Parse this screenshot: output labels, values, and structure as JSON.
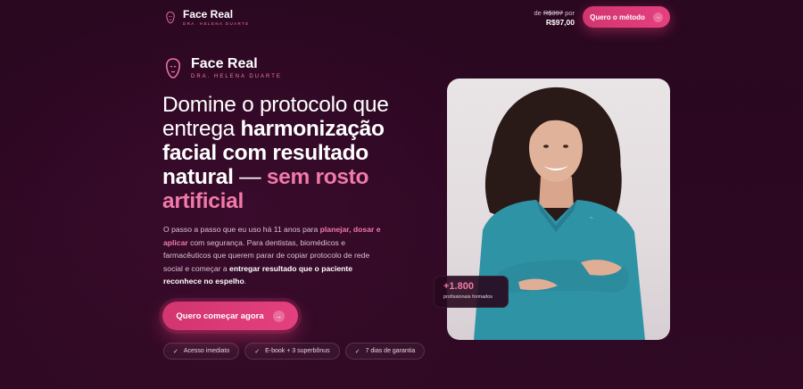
{
  "header": {
    "brand": "Face Real",
    "subtitle": "DRA. HELENA DUARTE",
    "price_prefix": "de",
    "price_old": "R$397",
    "price_suffix": "por",
    "price_new": "R$97,00",
    "cta_label": "Quero o método"
  },
  "hero": {
    "brand": "Face Real",
    "subtitle": "DRA. HELENA DUARTE",
    "headline": {
      "part1": "Domine o protocolo que entrega ",
      "part2": "harmonização facial com resultado natural",
      "part3": " — ",
      "part4": "sem rosto artificial"
    },
    "description": {
      "p1": "O passo a passo que eu uso há 11 anos para ",
      "p2": "planejar, dosar e aplicar",
      "p3": " com segurança. Para dentistas, biomédicos e farmacêuticos que querem parar de copiar protocolo de rede social e começar a ",
      "p4": "entregar resultado que o paciente reconhece no espelho",
      "p5": "."
    },
    "cta_label": "Quero começar agora",
    "chips": [
      "Acesso imediato",
      "E-book + 3 superbônus",
      "7 dias de garantia"
    ]
  },
  "stat": {
    "value": "+1.800",
    "label": "profissionais formados"
  },
  "colors": {
    "accent": "#e4407f",
    "accent_light": "#f07aa8",
    "background": "#2b0721"
  },
  "icons": [
    "face-logo-icon",
    "arrow-right-icon",
    "check-icon"
  ]
}
